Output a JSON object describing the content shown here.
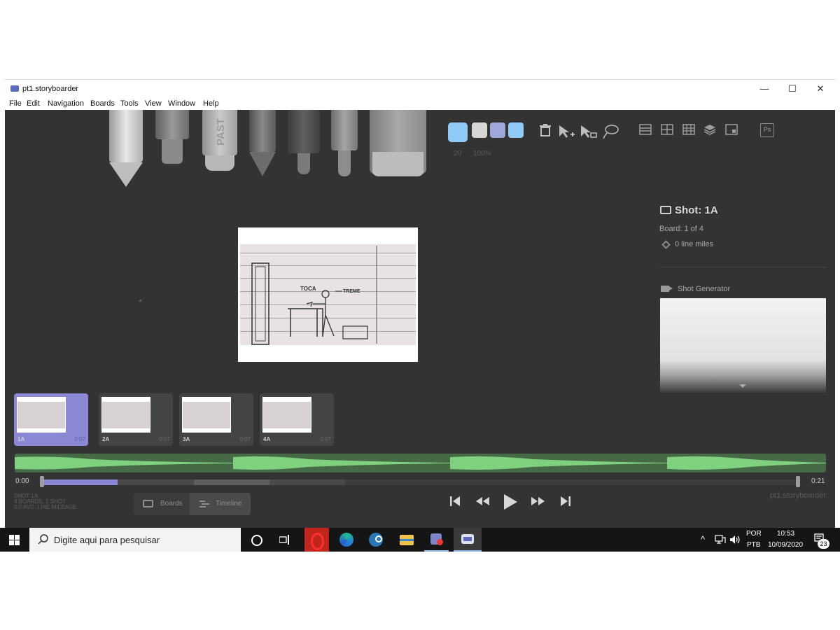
{
  "window": {
    "title": "pt1.storyboarder",
    "controls": {
      "minimize": "—",
      "maximize": "☐",
      "close": "✕"
    }
  },
  "menu": [
    "File",
    "Edit",
    "Navigation",
    "Boards",
    "Tools",
    "View",
    "Window",
    "Help"
  ],
  "toolbar": {
    "tools": [
      "light-pencil",
      "brush",
      "pastel",
      "pencil",
      "pen",
      "fine-pen",
      "eraser"
    ],
    "pastel_label": "PAST",
    "colors": [
      "#90caf9",
      "#d6d6d6",
      "#9fa8da",
      "#90caf9"
    ],
    "brush_size": "20",
    "brush_opacity": "100%",
    "icons": [
      "trash-icon",
      "select-add-icon",
      "select-replace-icon",
      "lasso-icon",
      "layout-icon-1",
      "grid-icon",
      "grid3-icon",
      "layers-icon",
      "aspect-icon",
      "photoshop-icon"
    ],
    "photoshop_label": "Ps"
  },
  "shot": {
    "title": "Shot: 1A",
    "board_count": "Board: 1 of 4",
    "line_miles": "0 line miles",
    "shot_generator_label": "Shot Generator"
  },
  "sketch_labels": {
    "left": "TOCA",
    "right": "TREME"
  },
  "boards": [
    {
      "label": "1A",
      "duration": "0:07",
      "active": true
    },
    {
      "label": "2A",
      "duration": "0:07",
      "active": false
    },
    {
      "label": "3A",
      "duration": "0:07",
      "active": false
    },
    {
      "label": "4A",
      "duration": "0:07",
      "active": false
    }
  ],
  "timeline": {
    "start": "0:00",
    "end": "0:21",
    "progress_fraction": 0.1
  },
  "info": {
    "line1": "SHOT 1A",
    "line2": "4 BOARDS, 1 SHOT",
    "line3": "0.0 AVG. LINE MILEAGE"
  },
  "modes": {
    "boards": "Boards",
    "timeline": "Timeline"
  },
  "footer_app_name": "pt1.storyboarder",
  "taskbar": {
    "search_placeholder": "Digite aqui para pesquisar",
    "lang_top": "POR",
    "lang_bottom": "PTB",
    "time": "10:53",
    "date": "10/09/2020",
    "notifications": "23",
    "tray_chevron": "^"
  }
}
